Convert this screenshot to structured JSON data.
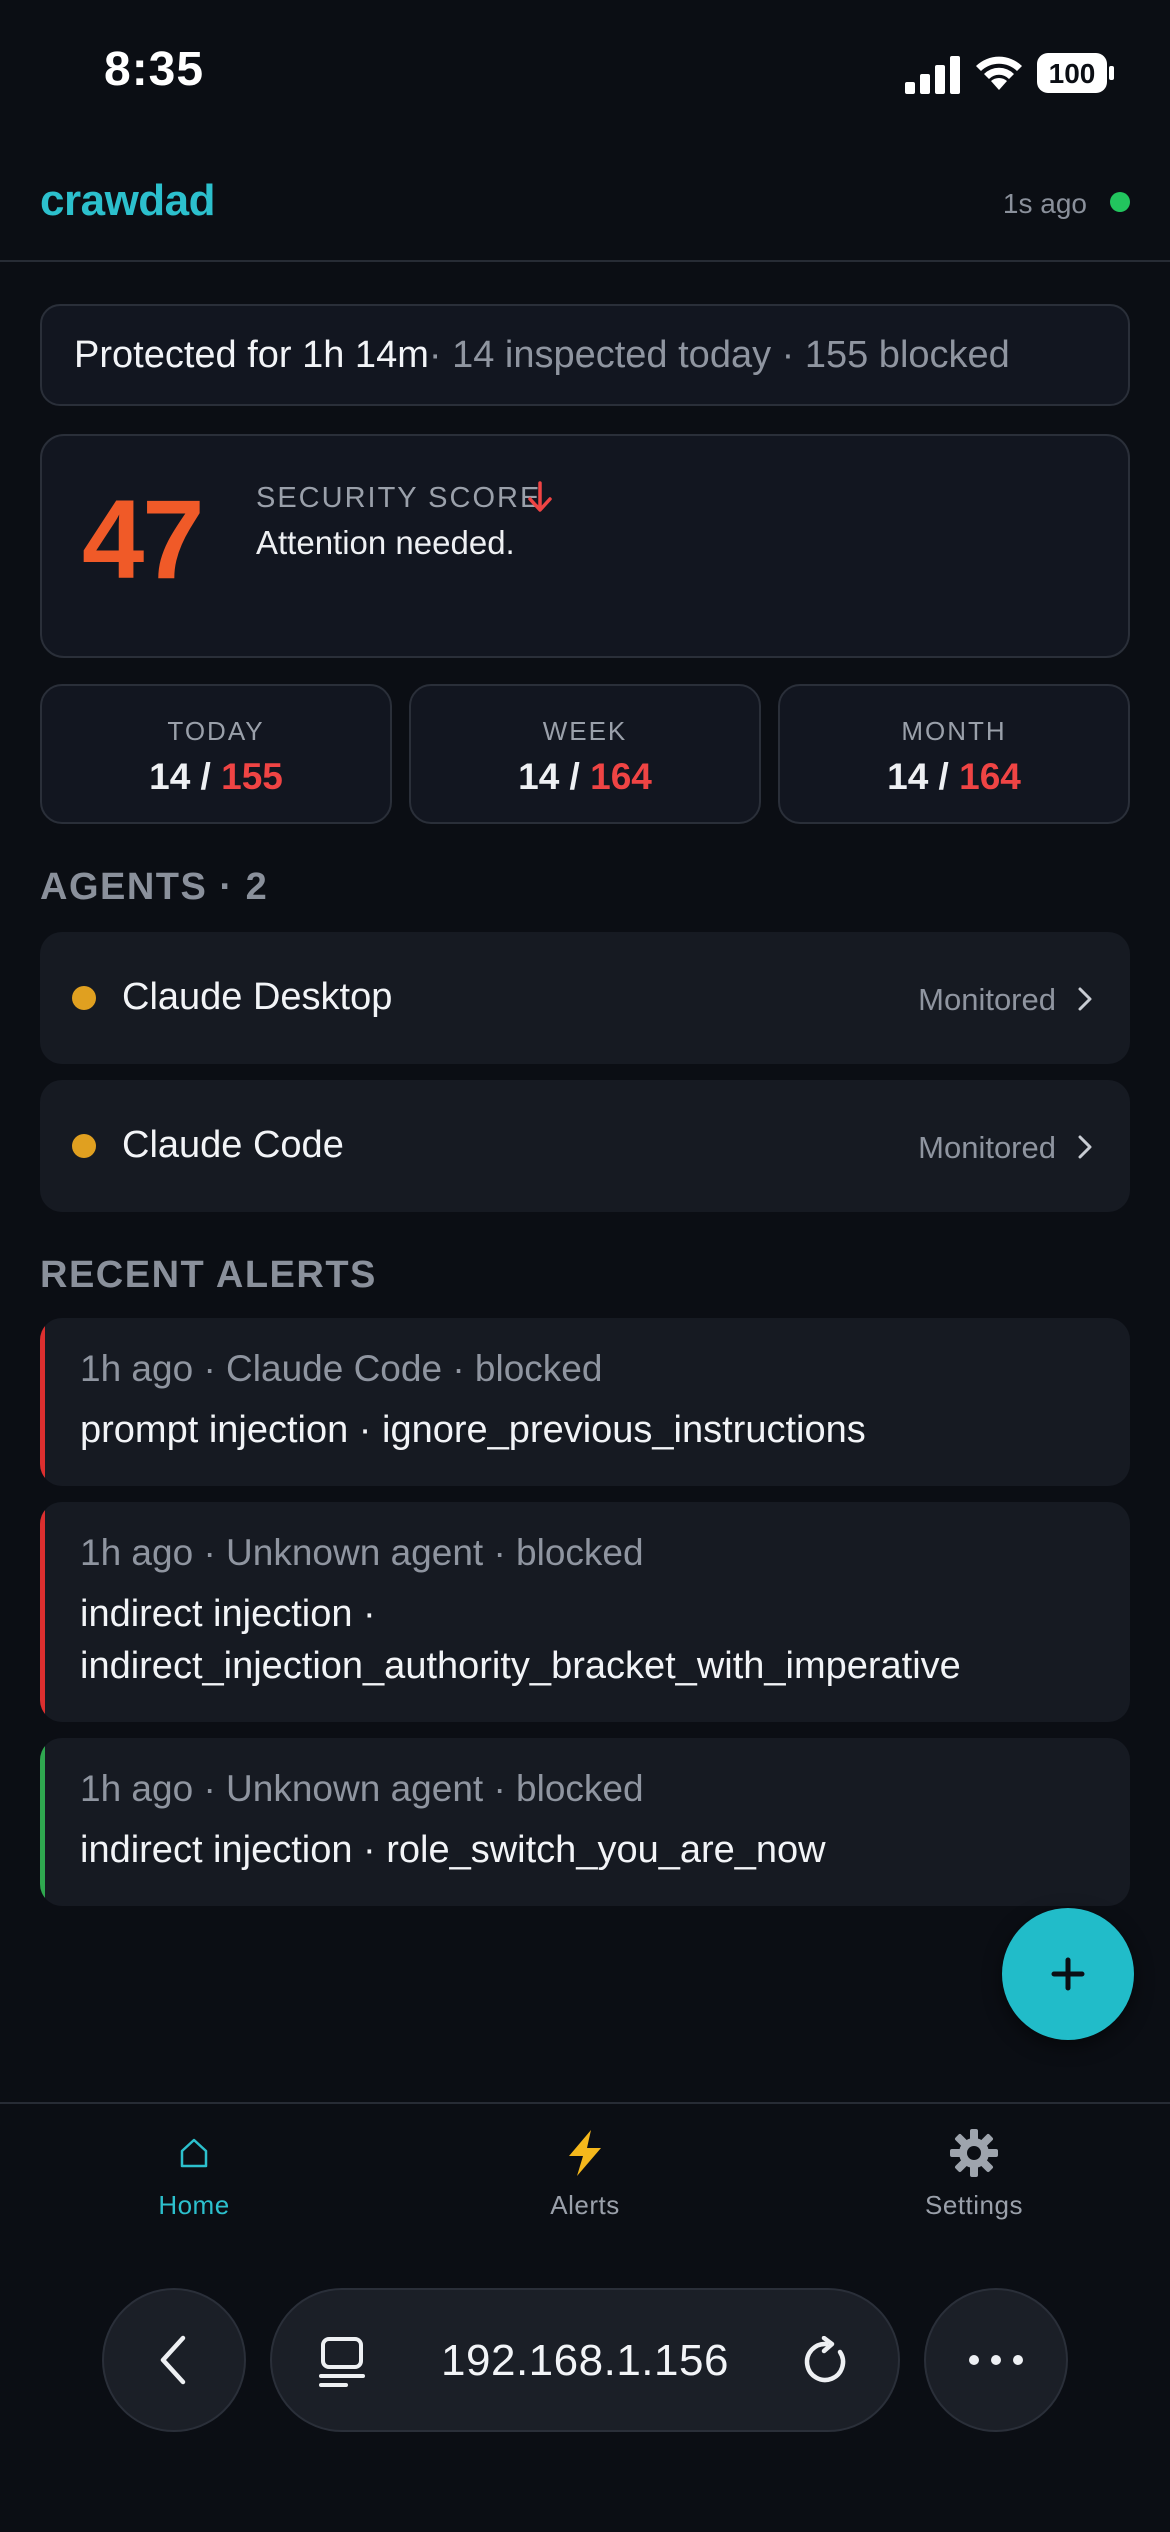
{
  "status_bar": {
    "time": "8:35",
    "battery": "100"
  },
  "header": {
    "brand": "crawdad",
    "updated": "1s ago"
  },
  "banner": {
    "protected": "Protected for 1h 14m",
    "details": " · 14 inspected today · 155 blocked"
  },
  "score": {
    "value": "47",
    "label": "SECURITY SCORE",
    "trend": "down",
    "message": "Attention needed."
  },
  "stats": [
    {
      "label": "TODAY",
      "inspected": "14",
      "blocked": "155"
    },
    {
      "label": "WEEK",
      "inspected": "14",
      "blocked": "164"
    },
    {
      "label": "MONTH",
      "inspected": "14",
      "blocked": "164"
    }
  ],
  "stats_separator": " / ",
  "agents": {
    "title": "AGENTS · 2",
    "items": [
      {
        "name": "Claude Desktop",
        "status": "Monitored",
        "dot_color": "#e0a020"
      },
      {
        "name": "Claude Code",
        "status": "Monitored",
        "dot_color": "#e0a020"
      }
    ]
  },
  "alerts": {
    "title": "RECENT ALERTS",
    "items": [
      {
        "meta": "1h ago · Claude Code · blocked",
        "body": "prompt injection · ignore_previous_instructions",
        "severity_color": "#dc2f2f"
      },
      {
        "meta": "1h ago · Unknown agent · blocked",
        "body": "indirect injection · indirect_injection_authority_bracket_with_imperative",
        "severity_color": "#dc2f2f"
      },
      {
        "meta": "1h ago · Unknown agent · blocked",
        "body": "indirect injection · role_switch_you_are_now",
        "severity_color": "#2fa84f"
      }
    ]
  },
  "fab": {
    "icon": "plus-icon"
  },
  "nav": [
    {
      "label": "Home",
      "icon": "home-icon",
      "active": true
    },
    {
      "label": "Alerts",
      "icon": "lightning-icon",
      "active": false
    },
    {
      "label": "Settings",
      "icon": "gear-icon",
      "active": false
    }
  ],
  "browser": {
    "url": "192.168.1.156"
  },
  "colors": {
    "accent": "#2cc0cd",
    "score": "#f05a28",
    "blocked": "#ef4444",
    "live": "#22c55e"
  }
}
